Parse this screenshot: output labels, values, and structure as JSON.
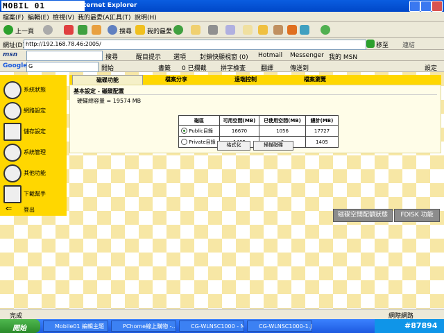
{
  "window": {
    "logo_text": "MOBIL 01",
    "title": "ternet Explorer"
  },
  "menubar": [
    "檔案(F)",
    "編輯(E)",
    "檢視(V)",
    "我的最愛(A)",
    "工具(T)",
    "說明(H)"
  ],
  "toolbar": {
    "back": "上一頁",
    "search": "搜尋",
    "favorites": "我的最愛"
  },
  "address": {
    "label": "網址(D)",
    "url": "http://192.168.78.46:2005/",
    "go": "移至",
    "links": "連結"
  },
  "msnbar": {
    "logo": "msn",
    "search": "搜尋",
    "highlight": "醒目提示",
    "options": "選項",
    "popup": "封鎖快顯視窗 (0)",
    "hotmail": "Hotmail",
    "messenger": "Messenger",
    "mymsn": "我的 MSN"
  },
  "googlebar": {
    "logo": "Google",
    "input_prefix": "G",
    "start": "開始",
    "bookmarks": "書籤",
    "blocked": "0 已攔截",
    "spellcheck": "拼字檢查",
    "translate": "翻譯",
    "sendto": "傳送到",
    "settings": "設定"
  },
  "tabs": [
    "磁碟功能",
    "檔案分享",
    "遠端控制",
    "檔案瀏覽"
  ],
  "sidebar": [
    "系統狀態",
    "網路設定",
    "儲存設定",
    "系統管理",
    "其他功能",
    "下載幫手",
    "登出"
  ],
  "content": {
    "heading": "基本設定 - 磁碟配置",
    "capacity": "硬碟總容量 = 19574 MB",
    "table_headers": [
      "磁區",
      "可用空間(MB)",
      "已使用空間(MB)",
      "總計(MB)"
    ],
    "rows": [
      {
        "name": "Public目錄",
        "free": "16670",
        "used": "1056",
        "total": "17727",
        "selected": true
      },
      {
        "name": "Private目錄",
        "free": "1405",
        "used": "0",
        "total": "1405",
        "selected": false
      }
    ],
    "format_button": "格式化",
    "scan_button": "掃描磁碟"
  },
  "right_buttons": {
    "disk_status": "磁碟空間配額狀態",
    "fdisk": "FDISK 功能"
  },
  "status": {
    "left": "完成",
    "right": "網際網路"
  },
  "taskbar": {
    "start": "開始",
    "tasks": [
      "Mobile01 編輯主題",
      "PChome線上購物 -...",
      "CG-WLNSC1000 - M...",
      "CG-WLNSC1000-1.J..."
    ]
  },
  "watermark": "#87894",
  "colors": {
    "sidebar": "#ffd700",
    "page_check": "#f7e7a5",
    "titlebar": "#0a5de0"
  }
}
